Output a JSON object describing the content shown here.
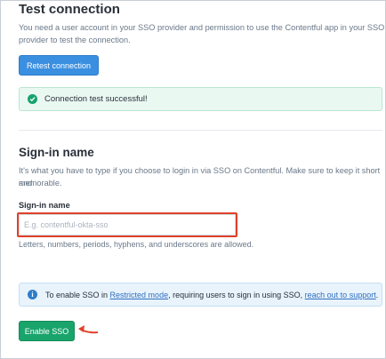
{
  "test_connection": {
    "title": "Test connection",
    "description_line1": "You need a user account in your SSO provider and permission to use the Contentful app in your SSO",
    "description_line2": "provider to test the connection.",
    "retest_button": "Retest connection",
    "success_message": "Connection test successful!"
  },
  "sign_in": {
    "title": "Sign-in name",
    "description_line1": "It's what you have to type if you choose to login in via SSO on Contentful. Make sure to keep it short and",
    "description_line2": "memorable.",
    "field_label": "Sign-in name",
    "input_placeholder": "E.g. contentful-okta-sso",
    "input_value": "",
    "hint": "Letters, numbers, periods, hyphens, and underscores are allowed."
  },
  "info_note": {
    "text_before": "To enable SSO in ",
    "link1": "Restricted mode",
    "text_middle": ", requiring users to sign in using SSO, ",
    "link2": "reach out to support",
    "text_after": "."
  },
  "enable_button": "Enable SSO",
  "colors": {
    "primary_blue": "#3a8fe0",
    "success_green": "#19a46b",
    "highlight_red": "#e0412b"
  },
  "icons": {
    "success": "check-circle-icon",
    "info": "info-circle-icon",
    "annotation": "arrow-left-icon"
  }
}
